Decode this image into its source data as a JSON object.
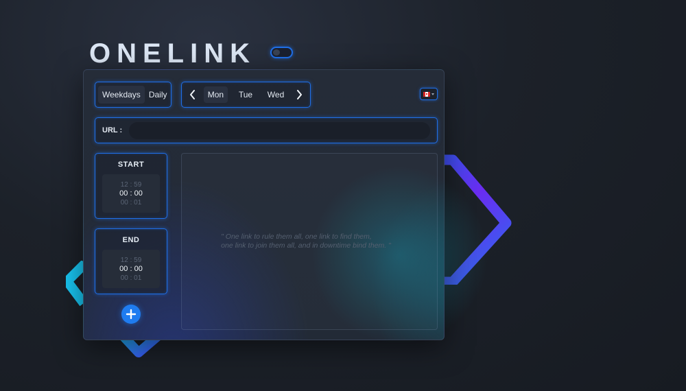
{
  "logo": {
    "text": "ONELINK"
  },
  "schedule_modes": [
    {
      "label": "Weekdays",
      "active": true
    },
    {
      "label": "Daily",
      "active": false
    }
  ],
  "days": [
    {
      "label": "Mon",
      "active": true
    },
    {
      "label": "Tue",
      "active": false
    },
    {
      "label": "Wed",
      "active": false
    }
  ],
  "icons": {
    "prev": "chevron-left-icon",
    "next": "chevron-right-icon",
    "add": "plus-icon",
    "language": "canada-flag-icon"
  },
  "url": {
    "label": "URL :",
    "value": "",
    "placeholder": ""
  },
  "start": {
    "title": "START",
    "above": "12 : 59",
    "selected": "00 : 00",
    "below": "00 : 01"
  },
  "end": {
    "title": "END",
    "above": "12 : 59",
    "selected": "00 : 00",
    "below": "00 : 01"
  },
  "quote": {
    "line1": "\" One link to rule them all,  one link to find them,",
    "line2": "one link to join them all, and in downtime bind them. \""
  },
  "colors": {
    "accent": "#1f6fe8",
    "add_button": "#1f7cf0",
    "background": "#1c2129",
    "panel": "#242b37"
  }
}
